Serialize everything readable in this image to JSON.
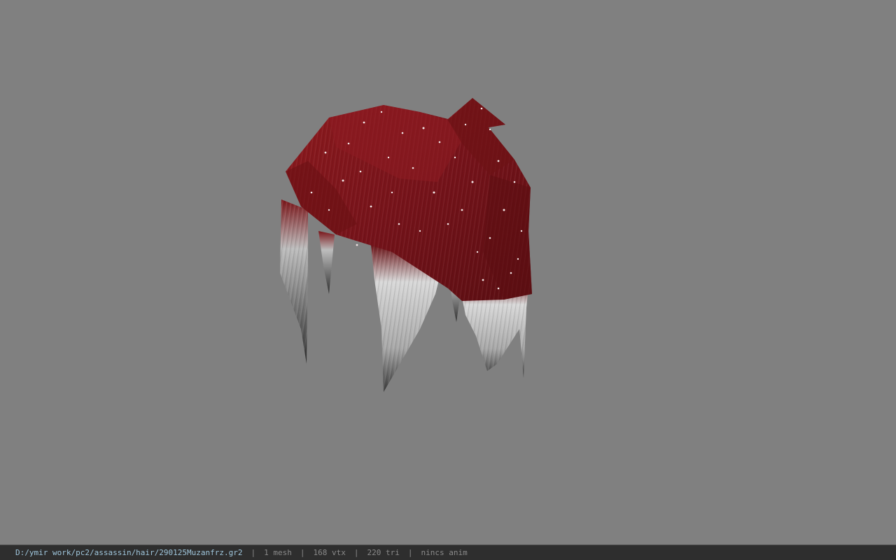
{
  "status_bar": {
    "file_path": "D:/ymir work/pc2/assassin/hair/290125Muzanfrz.gr2",
    "separator": "|",
    "mesh_count": "1 mesh",
    "vertex_count": "168 vtx",
    "triangle_count": "220 tri",
    "animation": "nincs anim"
  },
  "colors": {
    "background": "#808080",
    "hair_red": "#7a1418",
    "hair_tips": "#c8c8c8",
    "status_bar_bg": "#2e2e2e",
    "path_text": "#9fc6dc",
    "stat_text": "#8a8a8a"
  }
}
